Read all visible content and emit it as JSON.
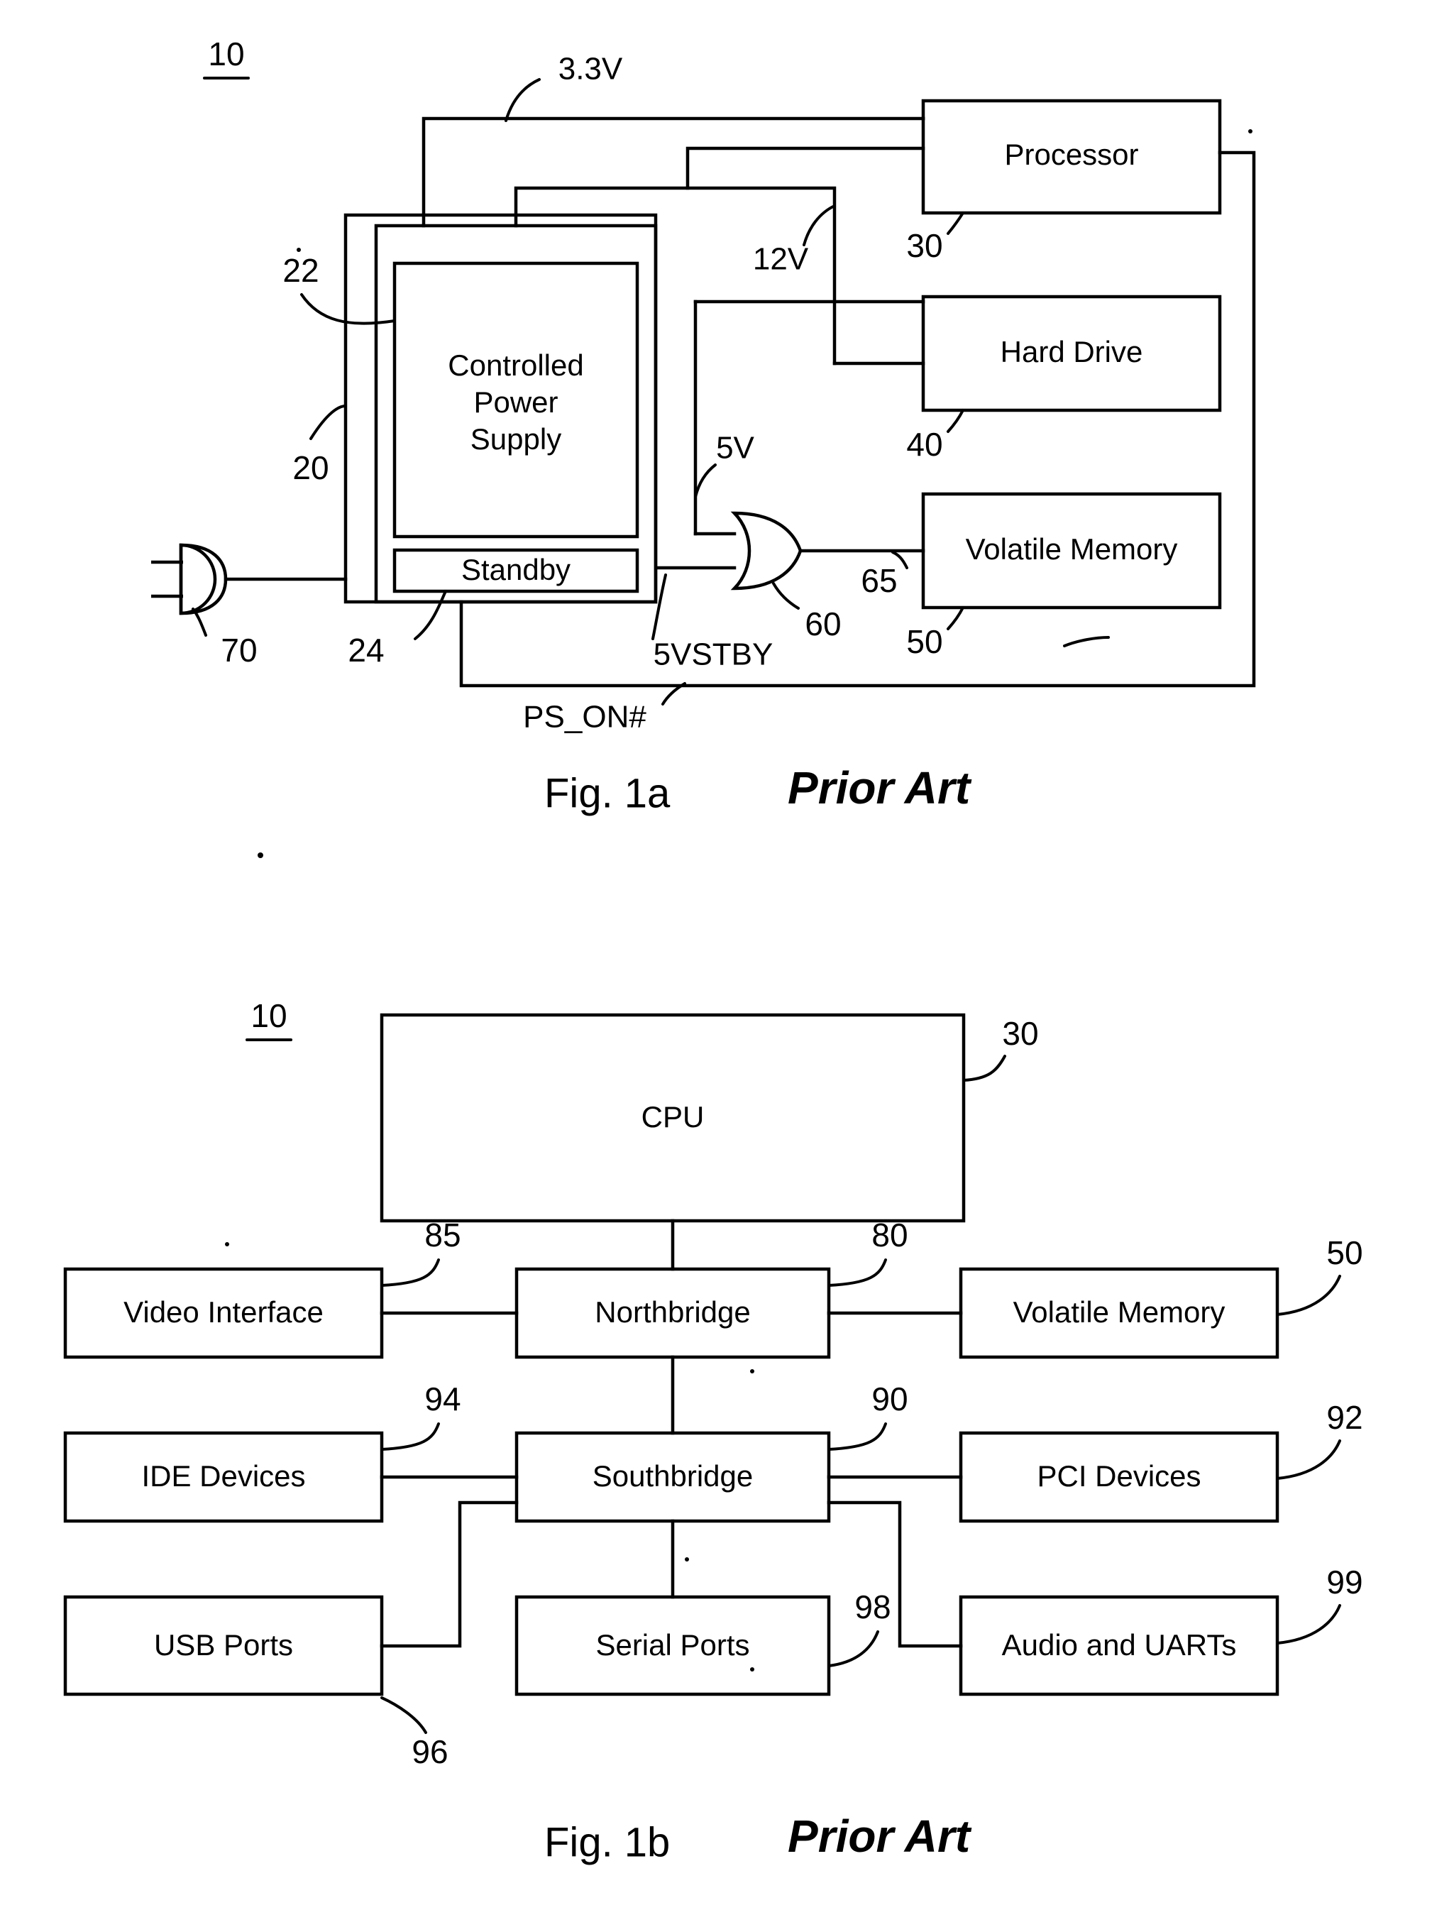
{
  "document": {
    "type": "patent-drawing-sheet",
    "figures": [
      {
        "id": "fig1a",
        "caption": "Fig. 1a",
        "note": "Prior Art",
        "system_ref": "10",
        "blocks": [
          {
            "key": "controlled_power_supply",
            "label": "Controlled Power Supply",
            "ref": "22"
          },
          {
            "key": "power_supply_outer",
            "label": "",
            "ref": "20"
          },
          {
            "key": "standby",
            "label": "Standby",
            "ref": "24"
          },
          {
            "key": "processor",
            "label": "Processor",
            "ref": "30"
          },
          {
            "key": "hard_drive",
            "label": "Hard Drive",
            "ref": "40"
          },
          {
            "key": "volatile_memory",
            "label": "Volatile Memory",
            "ref": "50"
          },
          {
            "key": "or_gate",
            "label": "",
            "ref": "60"
          },
          {
            "key": "or_gate_output",
            "label": "",
            "ref": "65"
          },
          {
            "key": "ac_plug",
            "label": "",
            "ref": "70"
          }
        ],
        "signals": [
          {
            "key": "v33",
            "label": "3.3V"
          },
          {
            "key": "v12",
            "label": "12V"
          },
          {
            "key": "v5",
            "label": "5V"
          },
          {
            "key": "v5stby",
            "label": "5VSTBY"
          },
          {
            "key": "ps_on",
            "label": "PS_ON#"
          }
        ],
        "lines": [
          {
            "key": "ps_label_33",
            "text": "Controlled"
          },
          {
            "key": "ps_label_2",
            "text": "Power"
          },
          {
            "key": "ps_label_3",
            "text": "Supply"
          }
        ]
      },
      {
        "id": "fig1b",
        "caption": "Fig. 1b",
        "note": "Prior Art",
        "system_ref": "10",
        "blocks": [
          {
            "key": "cpu",
            "label": "CPU",
            "ref": "30"
          },
          {
            "key": "video_interface",
            "label": "Video Interface",
            "ref": "85"
          },
          {
            "key": "northbridge",
            "label": "Northbridge",
            "ref": "80"
          },
          {
            "key": "volatile_memory",
            "label": "Volatile Memory",
            "ref": "50"
          },
          {
            "key": "ide_devices",
            "label": "IDE Devices",
            "ref": "94"
          },
          {
            "key": "southbridge",
            "label": "Southbridge",
            "ref": "90"
          },
          {
            "key": "pci_devices",
            "label": "PCI Devices",
            "ref": "92"
          },
          {
            "key": "usb_ports",
            "label": "USB Ports",
            "ref": "96"
          },
          {
            "key": "serial_ports",
            "label": "Serial Ports",
            "ref": "98"
          },
          {
            "key": "audio_uarts",
            "label": "Audio and UARTs",
            "ref": "99"
          }
        ]
      }
    ]
  },
  "colors": {
    "ink": "#000000",
    "paper": "#ffffff"
  }
}
